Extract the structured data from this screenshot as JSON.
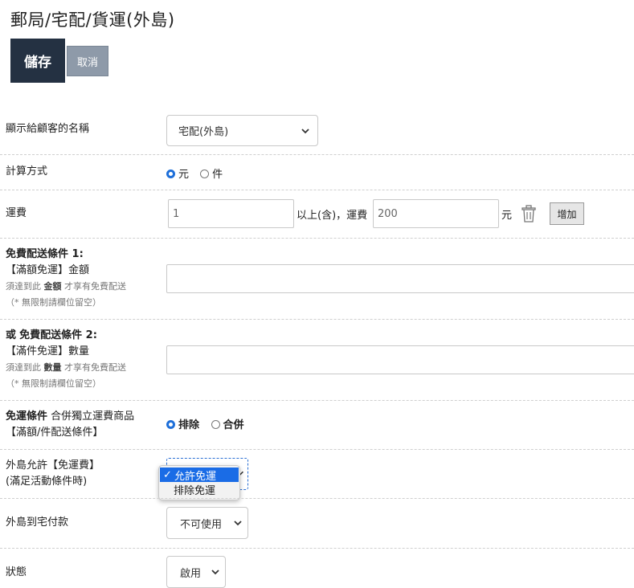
{
  "page": {
    "title": "郵局/宅配/貨運(外島)"
  },
  "toolbar": {
    "save_label": "儲存",
    "cancel_label": "取消"
  },
  "display_name": {
    "label": "顯示給顧客的名稱",
    "selected": "宅配(外島)"
  },
  "calc_method": {
    "label": "計算方式",
    "options": [
      "元",
      "件"
    ],
    "selected": "元"
  },
  "shipping_fee": {
    "label": "運費",
    "threshold_value": "1",
    "between_text": "以上(含)，運費",
    "fee_value": "200",
    "unit": "元",
    "add_label": "增加"
  },
  "free_cond_1": {
    "title": "免費配送條件 1:",
    "subtitle": "【滿額免運】金額",
    "hint_prefix": "須達到此",
    "hint_key": "金額",
    "hint_suffix": "才享有免費配送",
    "hint2": "（* 無限制請欄位留空）",
    "value": ""
  },
  "free_cond_2": {
    "prefix": "或",
    "title": "免費配送條件 2:",
    "subtitle": "【滿件免運】數量",
    "hint_prefix": "須達到此",
    "hint_key": "數量",
    "hint_suffix": "才享有免費配送",
    "hint2": "（* 無限制請欄位留空）",
    "value": ""
  },
  "free_rule": {
    "title": "免運條件",
    "title_rest": "合併獨立運費商品",
    "subtitle": "【滿額/件配送條件】",
    "options": [
      "排除",
      "合併"
    ],
    "selected": "排除"
  },
  "island_allow": {
    "label": "外島允許【免運費】",
    "label2": "(滿足活動條件時)",
    "options": [
      "允許免運",
      "排除免運"
    ],
    "selected": "允許免運"
  },
  "cod": {
    "label": "外島到宅付款",
    "selected": "不可使用"
  },
  "status": {
    "label": "狀態",
    "selected": "啟用"
  },
  "colors": {
    "primary": "#243142",
    "secondary": "#8e9aa9",
    "accent": "#1a6ce6"
  },
  "icons": {
    "trash": "trash-icon",
    "chevron": "chevron-down-icon",
    "check": "check-icon"
  }
}
